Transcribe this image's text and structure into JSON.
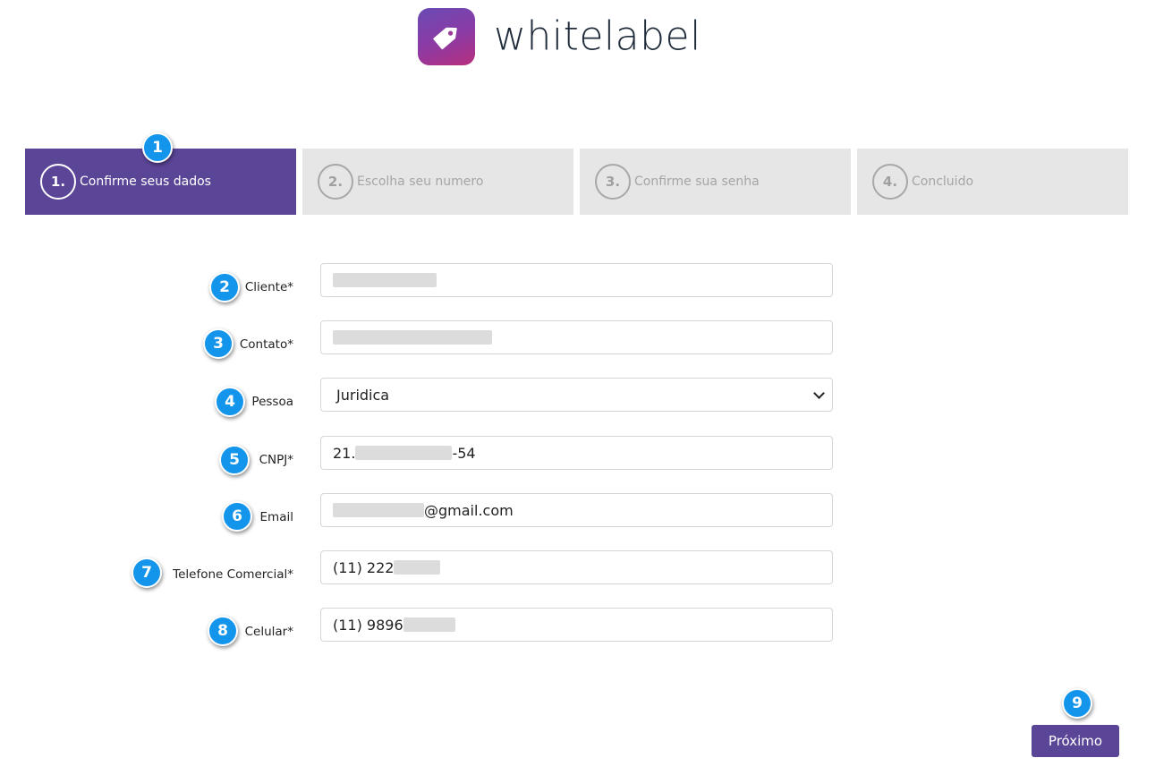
{
  "brand": {
    "name": "whitelabel"
  },
  "steps": [
    {
      "number": "1.",
      "label": "Confirme seus dados",
      "active": true
    },
    {
      "number": "2.",
      "label": "Escolha seu numero",
      "active": false
    },
    {
      "number": "3.",
      "label": "Confirme sua senha",
      "active": false
    },
    {
      "number": "4.",
      "label": "Concluido",
      "active": false
    }
  ],
  "form": {
    "cliente": {
      "label": "Cliente*",
      "value": ""
    },
    "contato": {
      "label": "Contato*",
      "value": ""
    },
    "pessoa": {
      "label": "Pessoa",
      "selected": "Juridica"
    },
    "cnpj": {
      "label": "CNPJ*",
      "value_start": "21.",
      "value_end": "-54"
    },
    "email": {
      "label": "Email",
      "value_end": "@gmail.com"
    },
    "telefone": {
      "label": "Telefone Comercial*",
      "value_start": "(11) 222"
    },
    "celular": {
      "label": "Celular*",
      "value_start": "(11) 9896"
    }
  },
  "buttons": {
    "next": "Próximo"
  },
  "badges": [
    "1",
    "2",
    "3",
    "4",
    "5",
    "6",
    "7",
    "8",
    "9"
  ],
  "colors": {
    "primary": "#5b4597",
    "step_inactive": "#e6e6e6",
    "badge": "#1495ec"
  }
}
